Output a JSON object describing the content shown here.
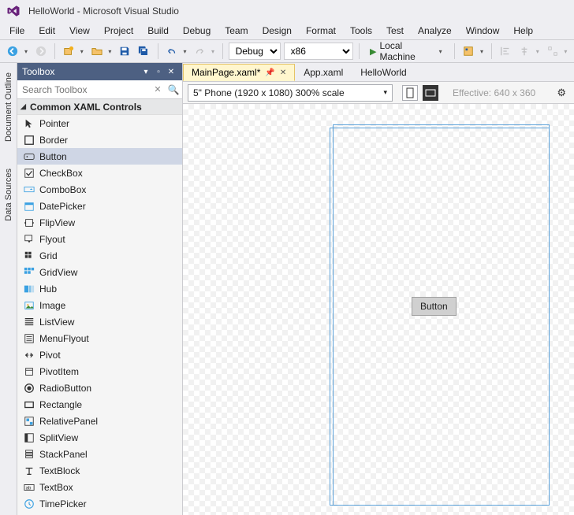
{
  "window": {
    "title": "HelloWorld - Microsoft Visual Studio"
  },
  "menubar": [
    "File",
    "Edit",
    "View",
    "Project",
    "Build",
    "Debug",
    "Team",
    "Design",
    "Format",
    "Tools",
    "Test",
    "Analyze",
    "Window",
    "Help"
  ],
  "toolbar": {
    "config_label": "Debug",
    "platform_label": "x86",
    "run_label": "Local Machine"
  },
  "side_tabs": [
    "Document Outline",
    "Data Sources"
  ],
  "toolbox": {
    "title": "Toolbox",
    "search_placeholder": "Search Toolbox",
    "group": "Common XAML Controls",
    "items": [
      "Pointer",
      "Border",
      "Button",
      "CheckBox",
      "ComboBox",
      "DatePicker",
      "FlipView",
      "Flyout",
      "Grid",
      "GridView",
      "Hub",
      "Image",
      "ListView",
      "MenuFlyout",
      "Pivot",
      "PivotItem",
      "RadioButton",
      "Rectangle",
      "RelativePanel",
      "SplitView",
      "StackPanel",
      "TextBlock",
      "TextBox",
      "TimePicker"
    ],
    "selected_index": 2
  },
  "docs": {
    "tabs": [
      {
        "label": "MainPage.xaml*",
        "active": true,
        "pinned": true,
        "closable": true
      },
      {
        "label": "App.xaml",
        "active": false
      },
      {
        "label": "HelloWorld",
        "active": false
      }
    ]
  },
  "designer": {
    "device_label": "5\" Phone (1920 x 1080) 300% scale",
    "effective_label": "Effective: 640 x 360",
    "canvas_button_text": "Button"
  }
}
